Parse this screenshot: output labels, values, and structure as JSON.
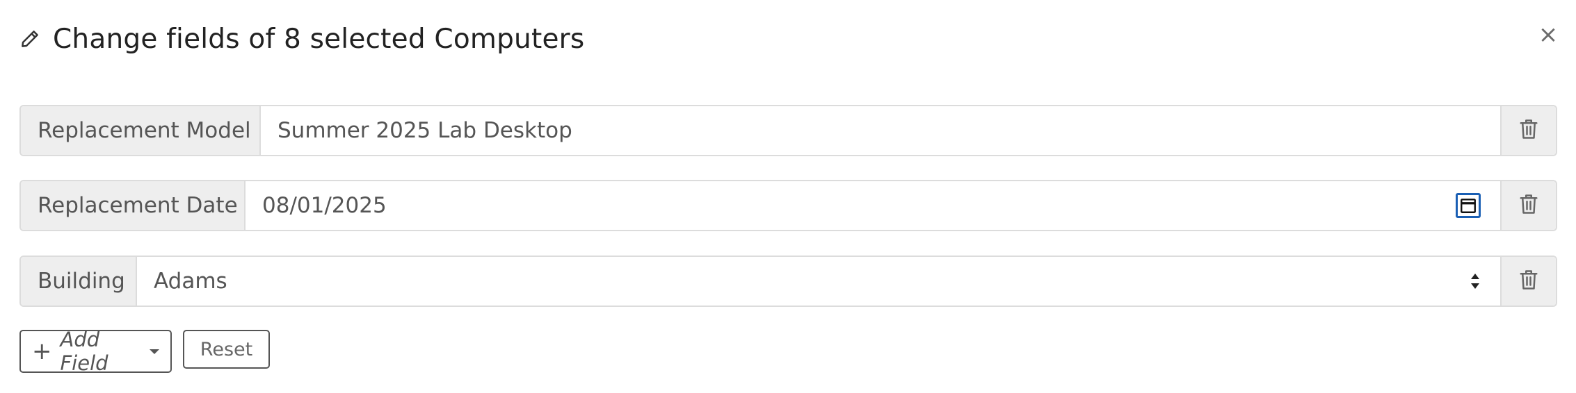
{
  "dialog": {
    "title": "Change fields of 8 selected Computers",
    "close_label": "×"
  },
  "fields": [
    {
      "label": "Replacement Model",
      "value": "Summer 2025 Lab Desktop",
      "type": "text"
    },
    {
      "label": "Replacement Date",
      "value": "08/01/2025",
      "type": "date"
    },
    {
      "label": "Building",
      "value": "Adams",
      "type": "select"
    }
  ],
  "actions": {
    "add_field_label": "Add Field",
    "reset_label": "Reset"
  },
  "icons": {
    "title": "pencil-icon",
    "close": "close-icon",
    "remove": "trash-icon",
    "date": "calendar-icon",
    "select": "sort-arrows-icon",
    "add": "plus-icon"
  },
  "colors": {
    "focus_outline": "#1a5fb4",
    "label_bg": "#eeeeee",
    "border": "#dcdcdc"
  }
}
